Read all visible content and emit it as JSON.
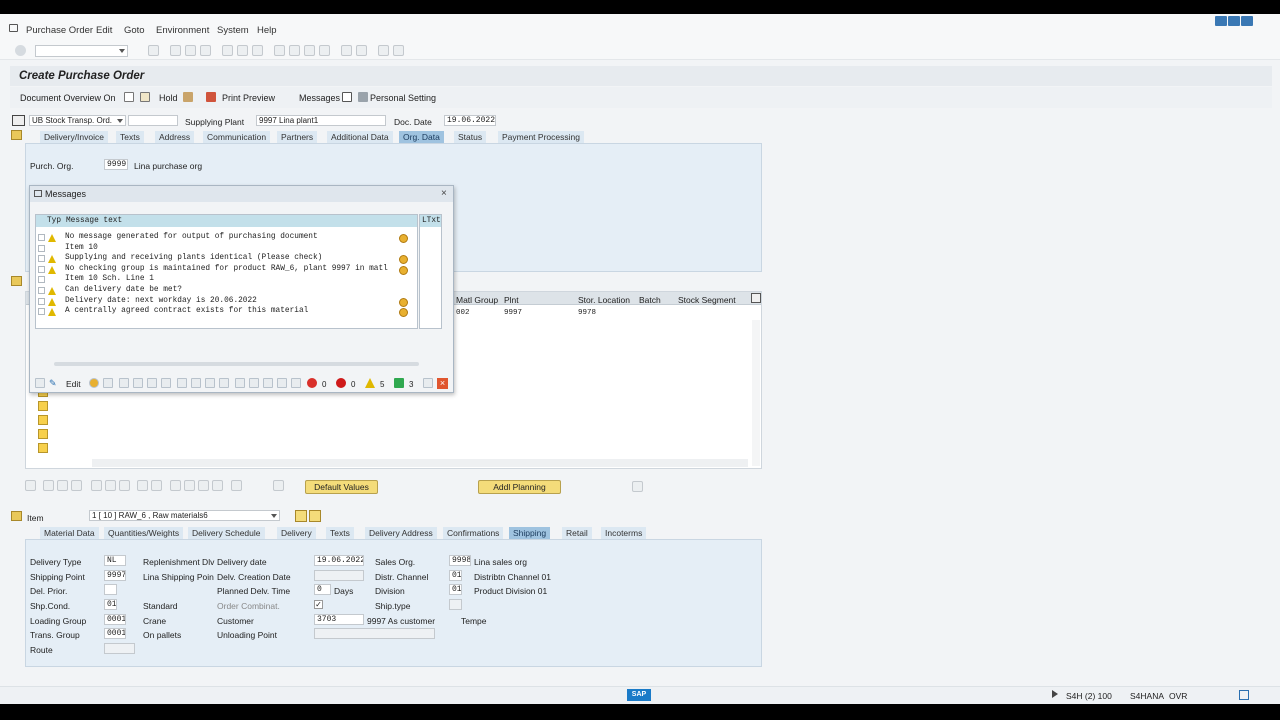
{
  "menu": [
    "Purchase Order",
    "Edit",
    "Goto",
    "Environment",
    "System",
    "Help"
  ],
  "page_title": "Create Purchase Order",
  "app_toolbar": {
    "doc_overview": "Document Overview On",
    "hold": "Hold",
    "print_preview": "Print Preview",
    "messages": "Messages",
    "personal_setting": "Personal Setting"
  },
  "header": {
    "order_type": "UB Stock Transp. Ord.",
    "supplying_plant_label": "Supplying Plant",
    "supplying_plant_value": "9997 Lina plant1",
    "doc_date_label": "Doc. Date",
    "doc_date_value": "19.06.2022"
  },
  "header_tabs": [
    "Delivery/Invoice",
    "Texts",
    "Address",
    "Communication",
    "Partners",
    "Additional Data",
    "Org. Data",
    "Status",
    "Payment Processing"
  ],
  "org": {
    "purch_org_label": "Purch. Org.",
    "purch_org_code": "9999",
    "purch_org_name": "Lina purchase org"
  },
  "item_grid": {
    "columns": [
      "Matl Group",
      "Plnt",
      "Stor. Location",
      "Batch",
      "Stock Segment"
    ],
    "row": [
      "002",
      "9997",
      "9978",
      "",
      ""
    ]
  },
  "buttons": {
    "default_values": "Default Values",
    "addl_planning": "Addl Planning"
  },
  "item_section": {
    "label": "Item",
    "selector": "1 [ 10 ] RAW_6 , Raw materials6"
  },
  "item_tabs": [
    "Material Data",
    "Quantities/Weights",
    "Delivery Schedule",
    "Delivery",
    "Texts",
    "Delivery Address",
    "Confirmations",
    "Shipping",
    "Retail",
    "Incoterms"
  ],
  "shipping": {
    "delivery_type_label": "Delivery Type",
    "delivery_type": "NL",
    "replenishment": "Replenishment Dlv",
    "shipping_point_label": "Shipping Point",
    "shipping_point": "9997",
    "shipping_point_name": "Lina Shipping Poin",
    "del_prior_label": "Del. Prior.",
    "shp_cond_label": "Shp.Cond.",
    "shp_cond": "01",
    "shp_cond_name": "Standard",
    "loading_group_label": "Loading Group",
    "loading_group": "0001",
    "loading_group_name": "Crane",
    "trans_group_label": "Trans. Group",
    "trans_group": "0001",
    "trans_group_name": "On pallets",
    "route_label": "Route",
    "delivery_date_label": "Delivery date",
    "delivery_date": "19.06.2022",
    "delv_creation_label": "Delv. Creation Date",
    "planned_delv_label": "Planned Delv. Time",
    "planned_delv": "0",
    "days": "Days",
    "order_combinat_label": "Order Combinat.",
    "customer_label": "Customer",
    "customer": "3703",
    "customer_name": "9997 As customer",
    "customer_city": "Tempe",
    "unloading_label": "Unloading Point",
    "sales_org_label": "Sales Org.",
    "sales_org": "9998",
    "sales_org_name": "Lina sales org",
    "distr_label": "Distr. Channel",
    "distr": "01",
    "distr_name": "Distribtn Channel 01",
    "division_label": "Division",
    "division": "01",
    "division_name": "Product Division 01",
    "ship_type_label": "Ship.type"
  },
  "dialog": {
    "title": "Messages",
    "col_typ": "Typ",
    "col_text": "Message text",
    "col_ltxt": "LTxt",
    "rows": [
      {
        "text": "No message generated for output of purchasing document",
        "warn": true,
        "ltxt": true
      },
      {
        "text": "Item 10",
        "warn": false,
        "ltxt": false
      },
      {
        "text": "Supplying and receiving plants identical (Please check)",
        "warn": true,
        "ltxt": true
      },
      {
        "text": "No checking group is maintained for product RAW_6, plant 9997 in matl",
        "warn": true,
        "ltxt": true
      },
      {
        "text": "Item 10 Sch. Line 1",
        "warn": false,
        "ltxt": false
      },
      {
        "text": "Can delivery date be met?",
        "warn": true,
        "ltxt": false
      },
      {
        "text": "Delivery date: next workday is 20.06.2022",
        "warn": true,
        "ltxt": true
      },
      {
        "text": "A centrally agreed contract exists for this material",
        "warn": true,
        "ltxt": true
      }
    ],
    "edit_label": "Edit",
    "count_error": "0",
    "count_stop": "0",
    "count_warn": "5",
    "count_ok": "3"
  },
  "status": {
    "system": "S4H (2) 100",
    "server": "S4HANA",
    "mode": "OVR"
  },
  "colors": {
    "accent": "#9fc3e0",
    "button": "#f4dc7a",
    "warn": "#e0b800"
  }
}
